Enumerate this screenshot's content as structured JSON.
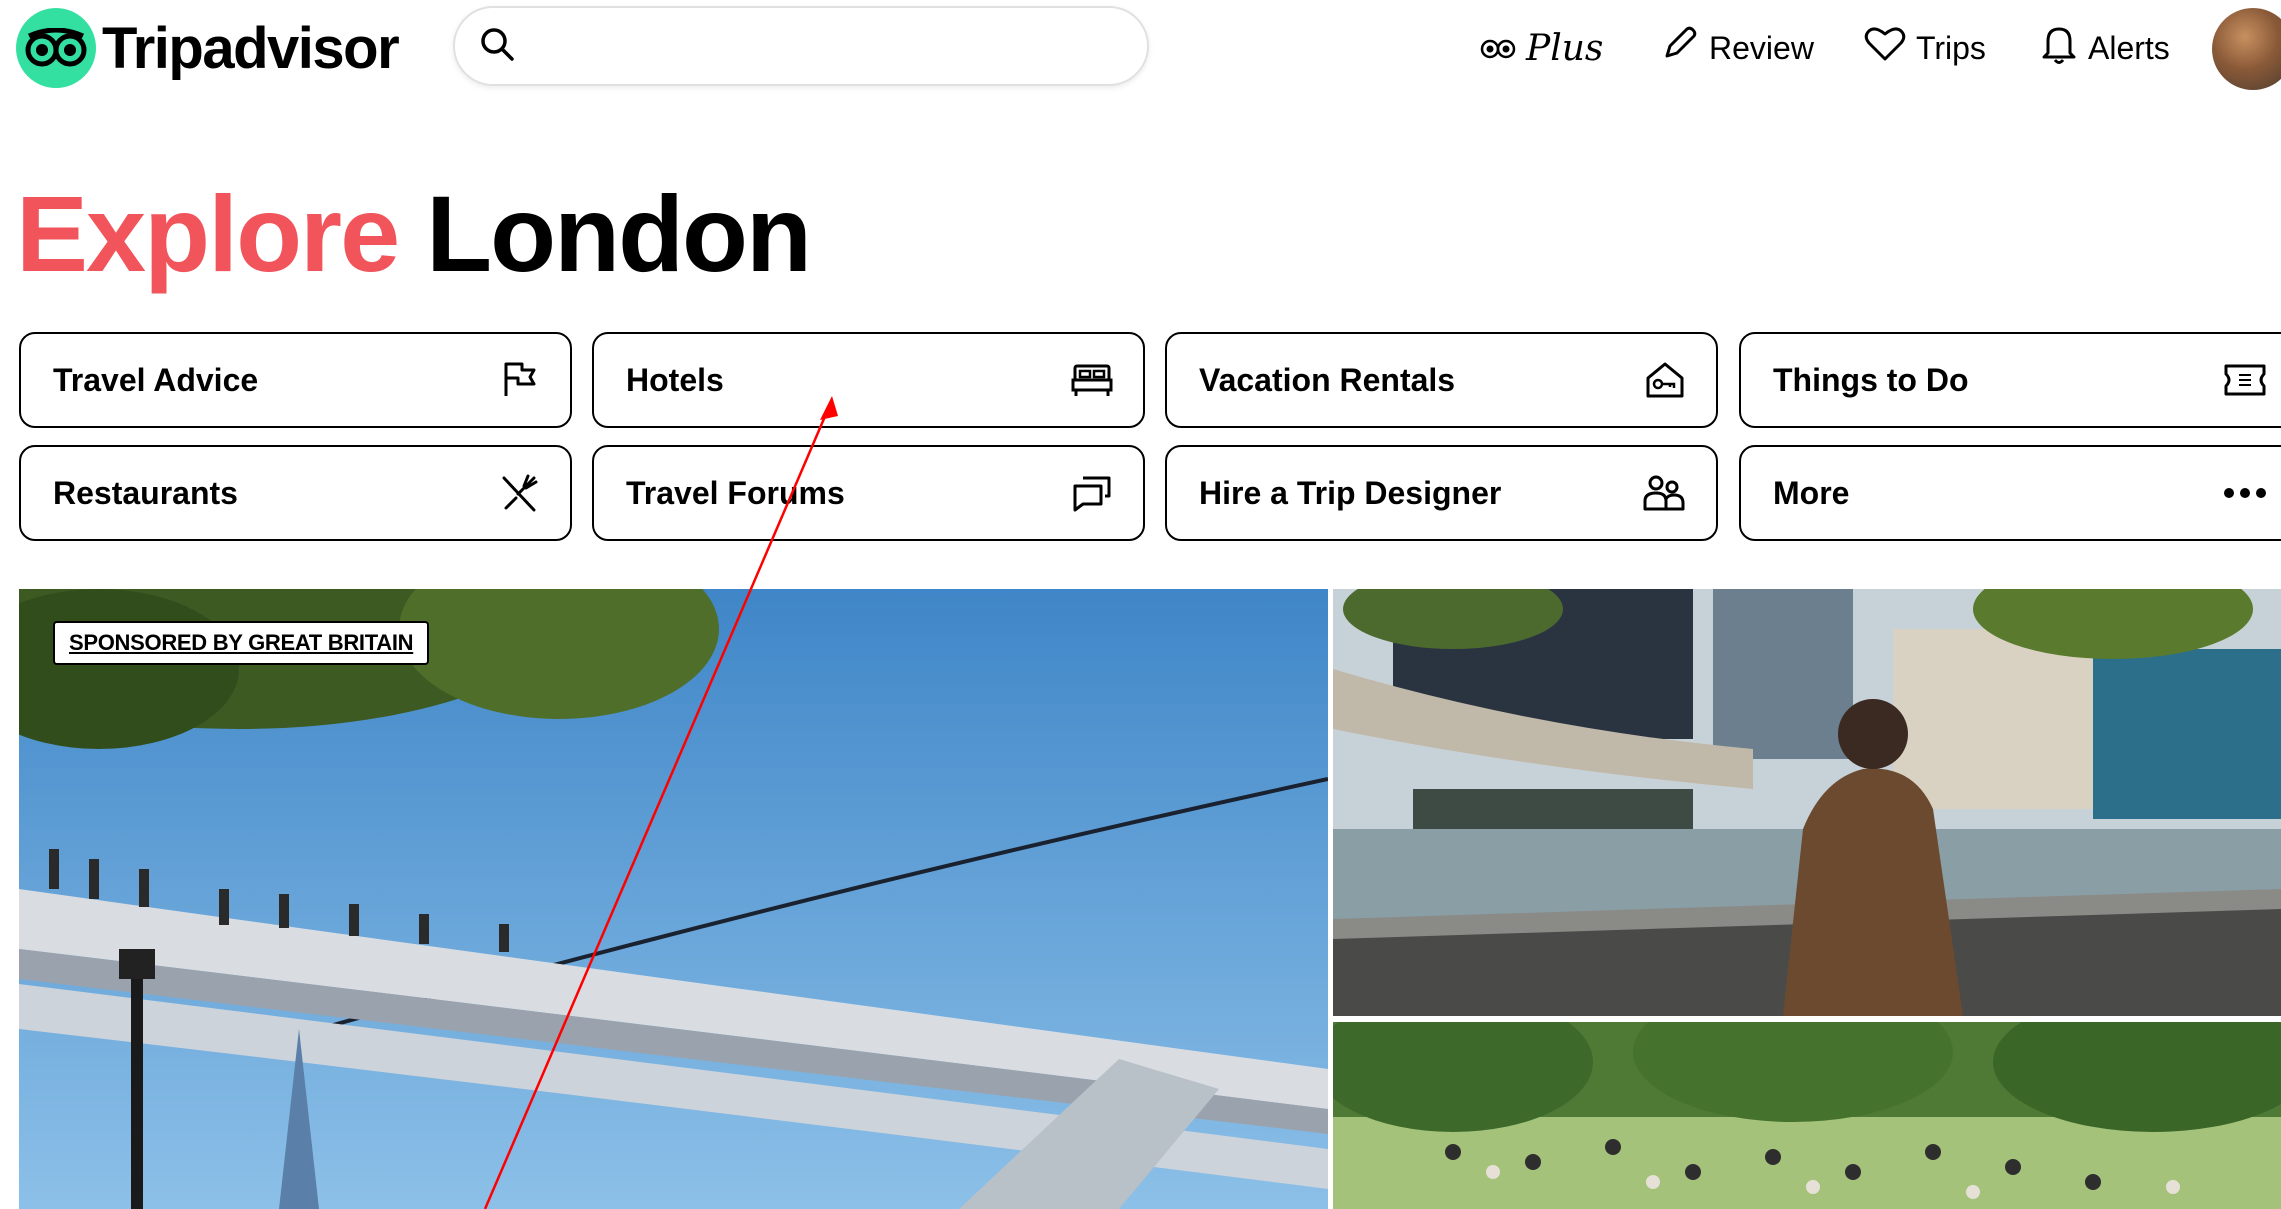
{
  "header": {
    "logo_text": "Tripadvisor",
    "search": {
      "value": "",
      "placeholder": ""
    },
    "nav": {
      "plus": "Plus",
      "review": "Review",
      "trips": "Trips",
      "alerts": "Alerts"
    }
  },
  "title": {
    "part1": "Explore",
    "part2": "London"
  },
  "categories": [
    {
      "label": "Travel Advice",
      "icon": "flag-icon"
    },
    {
      "label": "Hotels",
      "icon": "bed-icon"
    },
    {
      "label": "Vacation Rentals",
      "icon": "house-key-icon"
    },
    {
      "label": "Things to Do",
      "icon": "ticket-icon"
    },
    {
      "label": "Restaurants",
      "icon": "fork-knife-icon"
    },
    {
      "label": "Travel Forums",
      "icon": "chat-bubbles-icon"
    },
    {
      "label": "Hire a Trip Designer",
      "icon": "people-icon"
    },
    {
      "label": "More",
      "icon": "more-dots-icon"
    }
  ],
  "hero": {
    "sponsored_label": "SPONSORED BY GREAT BRITAIN"
  },
  "colors": {
    "brand_green": "#34e0a1",
    "accent_red": "#f2545b",
    "annotation_arrow": "#ff0000"
  }
}
